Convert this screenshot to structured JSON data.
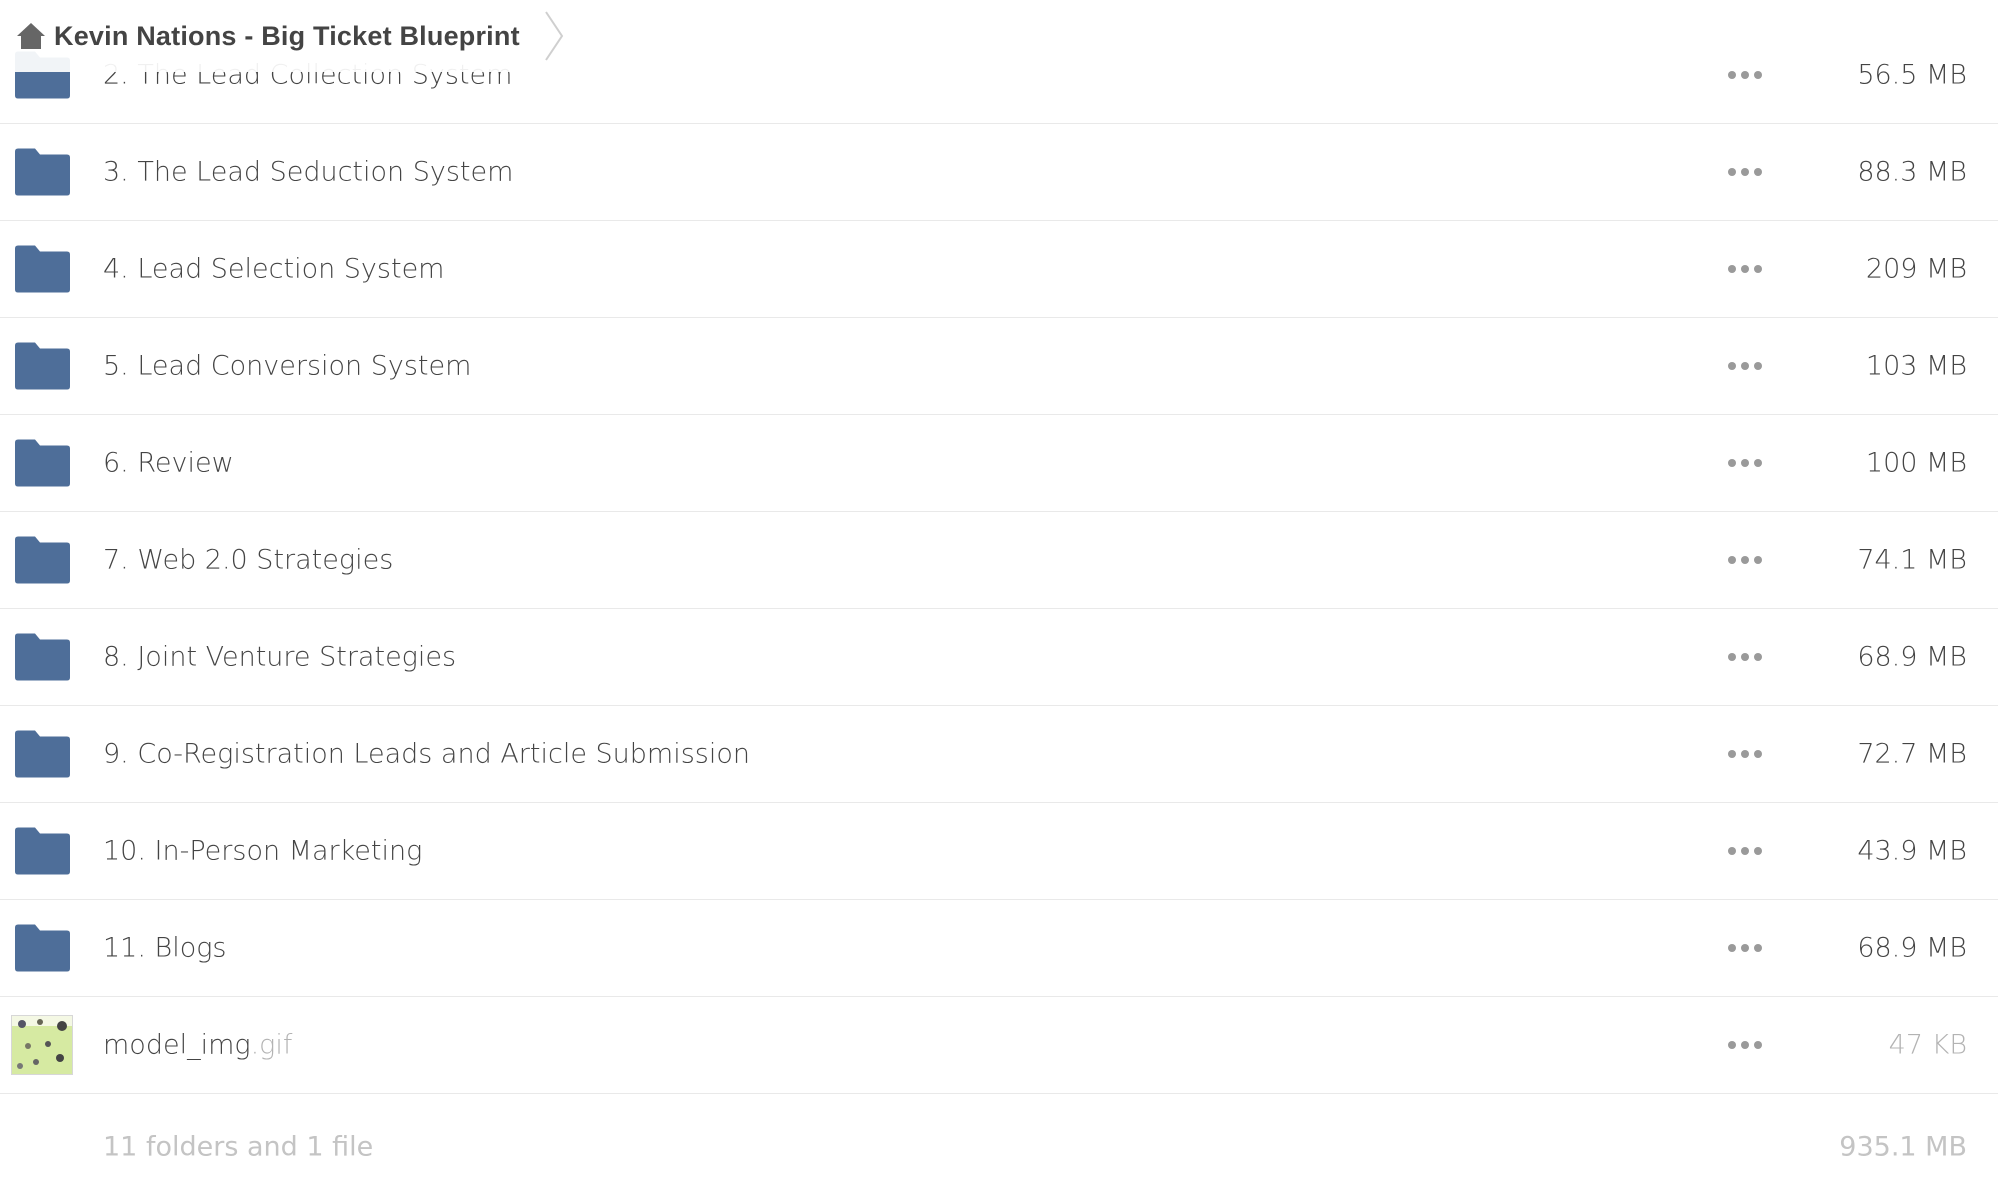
{
  "breadcrumb": {
    "home_icon": "home-icon",
    "folder_title": "Kevin Nations - Big Ticket Blueprint"
  },
  "colors": {
    "folder": "#4e6e99",
    "text": "#444444",
    "muted": "#b3b3b3",
    "divider": "#e9e9e9"
  },
  "items": [
    {
      "name": "2. The Lead Collection System",
      "size": "56.5 MB",
      "type": "folder"
    },
    {
      "name": "3. The Lead Seduction System",
      "size": "88.3 MB",
      "type": "folder"
    },
    {
      "name": "4. Lead Selection System",
      "size": "209 MB",
      "type": "folder"
    },
    {
      "name": "5. Lead Conversion System",
      "size": "103 MB",
      "type": "folder"
    },
    {
      "name": "6. Review",
      "size": "100 MB",
      "type": "folder"
    },
    {
      "name": "7. Web 2.0 Strategies",
      "size": "74.1 MB",
      "type": "folder"
    },
    {
      "name": "8. Joint Venture Strategies",
      "size": "68.9 MB",
      "type": "folder"
    },
    {
      "name": "9. Co-Registration Leads and Article Submission",
      "size": "72.7 MB",
      "type": "folder"
    },
    {
      "name": "10. In-Person Marketing",
      "size": "43.9 MB",
      "type": "folder"
    },
    {
      "name": "11. Blogs",
      "size": "68.9 MB",
      "type": "folder"
    },
    {
      "name": "model_img",
      "ext": ".gif",
      "size": "47 KB",
      "type": "file"
    }
  ],
  "summary": {
    "count": "11 folders and 1 file",
    "total": "935.1 MB"
  }
}
